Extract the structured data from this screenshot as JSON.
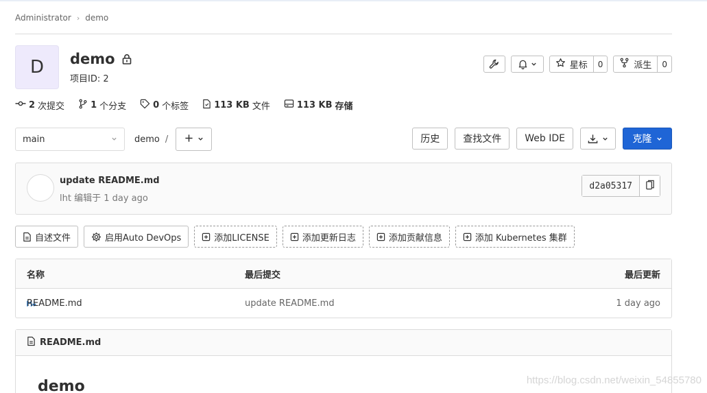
{
  "breadcrumb": {
    "parent": "Administrator",
    "current": "demo"
  },
  "project": {
    "avatar_letter": "D",
    "name": "demo",
    "id_label": "项目ID: 2"
  },
  "header_buttons": {
    "star_label": "星标",
    "star_count": "0",
    "fork_label": "派生",
    "fork_count": "0"
  },
  "stats": [
    {
      "value": "2",
      "label": "次提交"
    },
    {
      "value": "1",
      "label": "个分支"
    },
    {
      "value": "0",
      "label": "个标签"
    },
    {
      "value": "113 KB",
      "label": "文件"
    },
    {
      "value": "113 KB",
      "label": "存储"
    }
  ],
  "nav": {
    "branch": "main",
    "path_root": "demo",
    "path_sep": "/",
    "history": "历史",
    "find_file": "查找文件",
    "web_ide": "Web IDE",
    "clone": "克隆"
  },
  "commit": {
    "title": "update README.md",
    "meta": "lht 编辑于 1 day ago",
    "sha": "d2a05317"
  },
  "suggestions": [
    "自述文件",
    "启用Auto DevOps",
    "添加LICENSE",
    "添加更新日志",
    "添加贡献信息",
    "添加 Kubernetes 集群"
  ],
  "table": {
    "headers": {
      "name": "名称",
      "last_commit": "最后提交",
      "last_update": "最后更新"
    },
    "rows": [
      {
        "name": "README.md",
        "commit": "update README.md",
        "updated": "1 day ago"
      }
    ]
  },
  "readme": {
    "file_name": "README.md",
    "heading": "demo"
  },
  "watermark": "https://blog.csdn.net/weixin_54855780",
  "colors": {
    "primary": "#1f65d6",
    "avatar_bg": "#eeeafc",
    "border": "#dbdbdb"
  }
}
